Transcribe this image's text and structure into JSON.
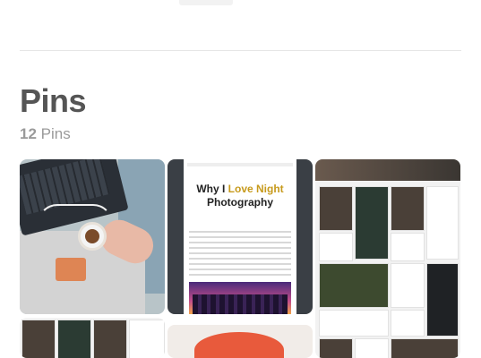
{
  "board": {
    "title": "Pins",
    "count": "12",
    "count_label": "Pins"
  },
  "pins": [
    {
      "name": "laptop-coffee-photo"
    },
    {
      "name": "blog-post-mockup",
      "headline_part1": "Why I ",
      "headline_highlight": "Love Night",
      "headline_part2": "Photography"
    },
    {
      "name": "app-screens-grid"
    },
    {
      "name": "app-screens-row"
    },
    {
      "name": "portrait-illustration"
    }
  ],
  "colors": {
    "title": "#555555",
    "count": "#9a9a9a",
    "accent": "#c79a1c"
  }
}
